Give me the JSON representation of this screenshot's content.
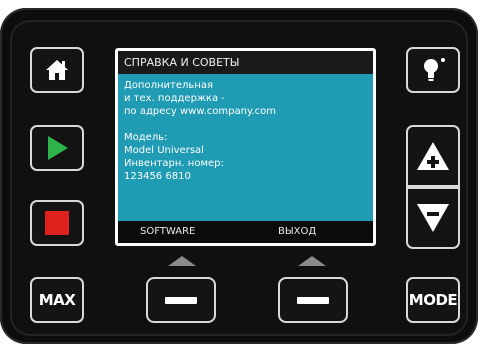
{
  "screen": {
    "title": "СПРАВКА И СОВЕТЫ",
    "body_lines_1": [
      "Дополнительная",
      "и тех. поддержка -",
      "по адресу www.company.com"
    ],
    "body_lines_2": [
      "Модель:",
      "Model Universal",
      "Инвентарн. номер:",
      "123456 6810"
    ],
    "softkey_left": "SOFTWARE",
    "softkey_right": "ВЫХОД"
  },
  "buttons": {
    "max_label": "MAX",
    "mode_label": "MODE"
  },
  "colors": {
    "screen_bg": "#1f9bb4",
    "play_green": "#2db34a",
    "stop_red": "#e0201c",
    "panel": "#0d0d0d"
  },
  "icons": {
    "home": "home-icon",
    "play": "play-icon",
    "stop": "stop-icon",
    "bulb": "lightbulb-icon",
    "up": "arrow-up-plus-icon",
    "down": "arrow-down-minus-icon"
  }
}
